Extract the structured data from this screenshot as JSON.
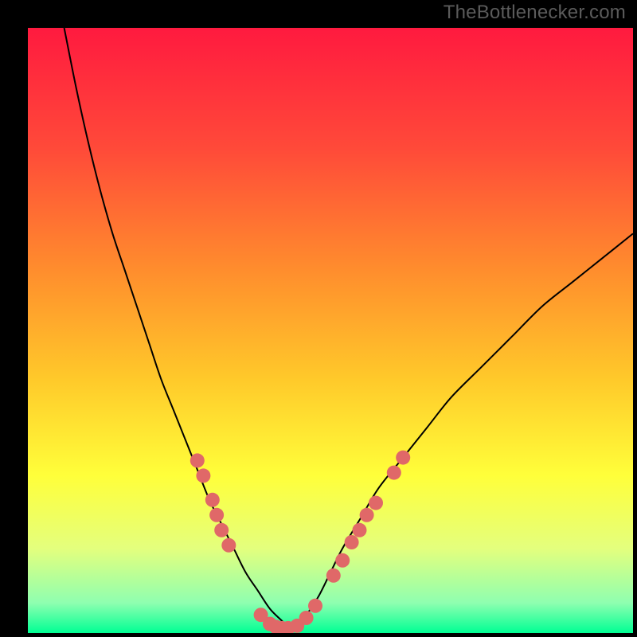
{
  "watermark": "TheBottlenecker.com",
  "chart_data": {
    "type": "line",
    "title": "",
    "xlabel": "",
    "ylabel": "",
    "xlim": [
      0,
      100
    ],
    "ylim": [
      0,
      100
    ],
    "grid": false,
    "legend": false,
    "background": "rainbow-vertical-gradient",
    "gradient_stops": [
      {
        "offset": 0.0,
        "color": "#ff1a3f"
      },
      {
        "offset": 0.2,
        "color": "#ff4a39"
      },
      {
        "offset": 0.4,
        "color": "#ff8d2d"
      },
      {
        "offset": 0.58,
        "color": "#ffc92a"
      },
      {
        "offset": 0.74,
        "color": "#ffff3a"
      },
      {
        "offset": 0.86,
        "color": "#e4ff7d"
      },
      {
        "offset": 0.95,
        "color": "#8fffb0"
      },
      {
        "offset": 1.0,
        "color": "#00ff94"
      }
    ],
    "series": [
      {
        "name": "curve",
        "stroke": "#000000",
        "x": [
          6,
          8,
          10,
          12,
          14,
          16,
          18,
          20,
          22,
          24,
          26,
          28,
          30,
          32,
          34,
          36,
          38,
          40,
          42,
          43,
          44,
          46,
          48,
          50,
          52,
          55,
          58,
          62,
          66,
          70,
          75,
          80,
          85,
          90,
          95,
          100
        ],
        "y": [
          100,
          90,
          81,
          73,
          66,
          60,
          54,
          48,
          42,
          37,
          32,
          27,
          22,
          18,
          14,
          10,
          7,
          4,
          2,
          1,
          1,
          3,
          6,
          10,
          14,
          19,
          24,
          29,
          34,
          39,
          44,
          49,
          54,
          58,
          62,
          66
        ]
      }
    ],
    "markers": [
      {
        "x": 28.0,
        "y": 28.5
      },
      {
        "x": 29.0,
        "y": 26.0
      },
      {
        "x": 30.5,
        "y": 22.0
      },
      {
        "x": 31.2,
        "y": 19.5
      },
      {
        "x": 32.0,
        "y": 17.0
      },
      {
        "x": 33.2,
        "y": 14.5
      },
      {
        "x": 38.5,
        "y": 3.0
      },
      {
        "x": 40.0,
        "y": 1.5
      },
      {
        "x": 41.0,
        "y": 1.0
      },
      {
        "x": 42.0,
        "y": 0.8
      },
      {
        "x": 43.0,
        "y": 0.8
      },
      {
        "x": 44.5,
        "y": 1.2
      },
      {
        "x": 46.0,
        "y": 2.5
      },
      {
        "x": 47.5,
        "y": 4.5
      },
      {
        "x": 50.5,
        "y": 9.5
      },
      {
        "x": 52.0,
        "y": 12.0
      },
      {
        "x": 53.5,
        "y": 15.0
      },
      {
        "x": 54.8,
        "y": 17.0
      },
      {
        "x": 56.0,
        "y": 19.5
      },
      {
        "x": 57.5,
        "y": 21.5
      },
      {
        "x": 60.5,
        "y": 26.5
      },
      {
        "x": 62.0,
        "y": 29.0
      }
    ],
    "marker_style": {
      "fill": "#e06868",
      "radius": 9
    }
  }
}
